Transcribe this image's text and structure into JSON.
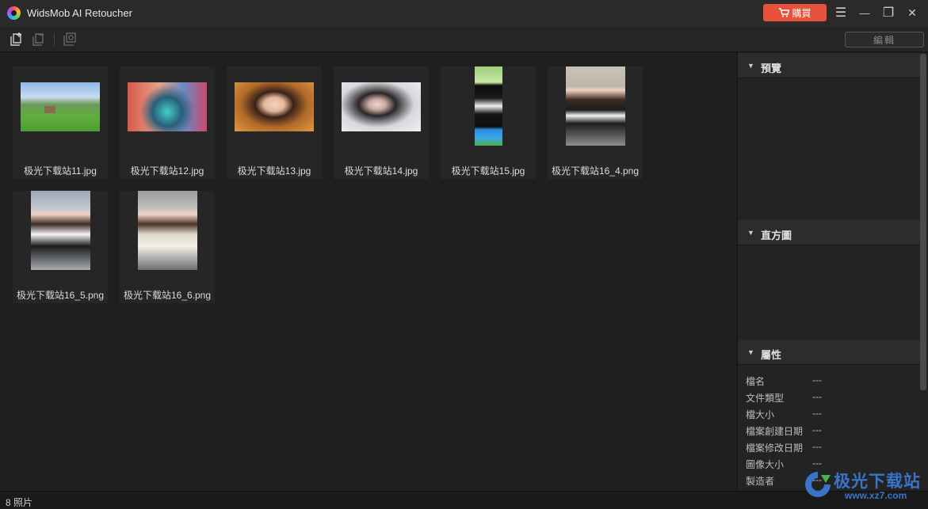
{
  "window": {
    "title": "WidsMob AI Retoucher",
    "buy_label": "購買",
    "menu_icon": "☰",
    "minimize_icon": "—",
    "restore_icon": "❐",
    "close_icon": "✕"
  },
  "toolbar": {
    "edit_label": "編輯"
  },
  "gallery": {
    "items": [
      {
        "name": "极光下载站11.jpg"
      },
      {
        "name": "极光下载站12.jpg"
      },
      {
        "name": "极光下载站13.jpg"
      },
      {
        "name": "极光下载站14.jpg"
      },
      {
        "name": "极光下载站15.jpg"
      },
      {
        "name": "极光下载站16_4.png"
      },
      {
        "name": "极光下载站16_5.png"
      },
      {
        "name": "极光下载站16_6.png"
      }
    ]
  },
  "sidebar": {
    "preview_title": "預覽",
    "histogram_title": "直方圖",
    "properties_title": "屬性",
    "properties": [
      {
        "key": "檔名",
        "value": "---"
      },
      {
        "key": "文件類型",
        "value": "---"
      },
      {
        "key": "檔大小",
        "value": "---"
      },
      {
        "key": "檔案創建日期",
        "value": "---"
      },
      {
        "key": "檔案修改日期",
        "value": "---"
      },
      {
        "key": "圖像大小",
        "value": "---"
      },
      {
        "key": "製造者",
        "value": "---"
      }
    ]
  },
  "status": {
    "text": "8 照片"
  },
  "watermark": {
    "name": "极光下载站",
    "url": "www.xz7.com"
  },
  "colors": {
    "accent": "#e8513b",
    "background": "#1e1e1e",
    "watermark": "#3a74c9"
  }
}
